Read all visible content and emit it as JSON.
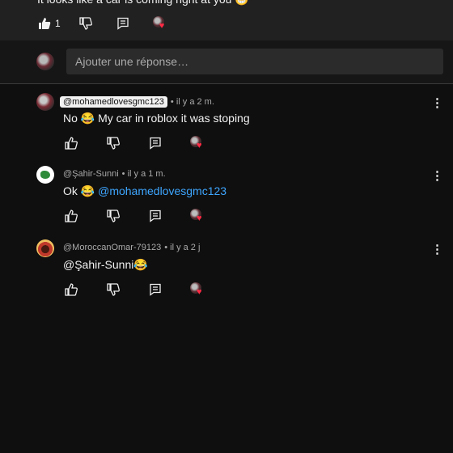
{
  "parent": {
    "text": "It looks like a car is coming right at you 😁",
    "like_count": "1"
  },
  "reply_box": {
    "placeholder": "Ajouter une réponse…"
  },
  "replies": [
    {
      "handle": "@mohamedlovesgmc123",
      "time": "• il y a 2 m.",
      "text_prefix": "No 😂 My car in roblox it was stoping",
      "mention": "",
      "avatar": "car-avatar"
    },
    {
      "handle": "@Şahir-Sunni",
      "time": "• il y a 1 m.",
      "text_prefix": "Ok 😂 ",
      "mention": "@mohamedlovesgmc123",
      "avatar": "green-logo-avatar"
    },
    {
      "handle": "@MoroccanOmar-79123",
      "time": "• il y a 2 j",
      "text_prefix": "@Şahir-Sunni😂",
      "mention": "",
      "avatar": "face-avatar"
    }
  ],
  "icons": {
    "like": "thumb-up-icon",
    "dislike": "thumb-down-icon",
    "reply": "reply-icon",
    "hearted": "creator-heart-icon",
    "more": "more-vert-icon"
  },
  "colors": {
    "background": "#0f0f0f",
    "panel": "#212121",
    "input": "#2b2b2b",
    "mention": "#3ea6ff",
    "heart": "#ff2a44"
  }
}
